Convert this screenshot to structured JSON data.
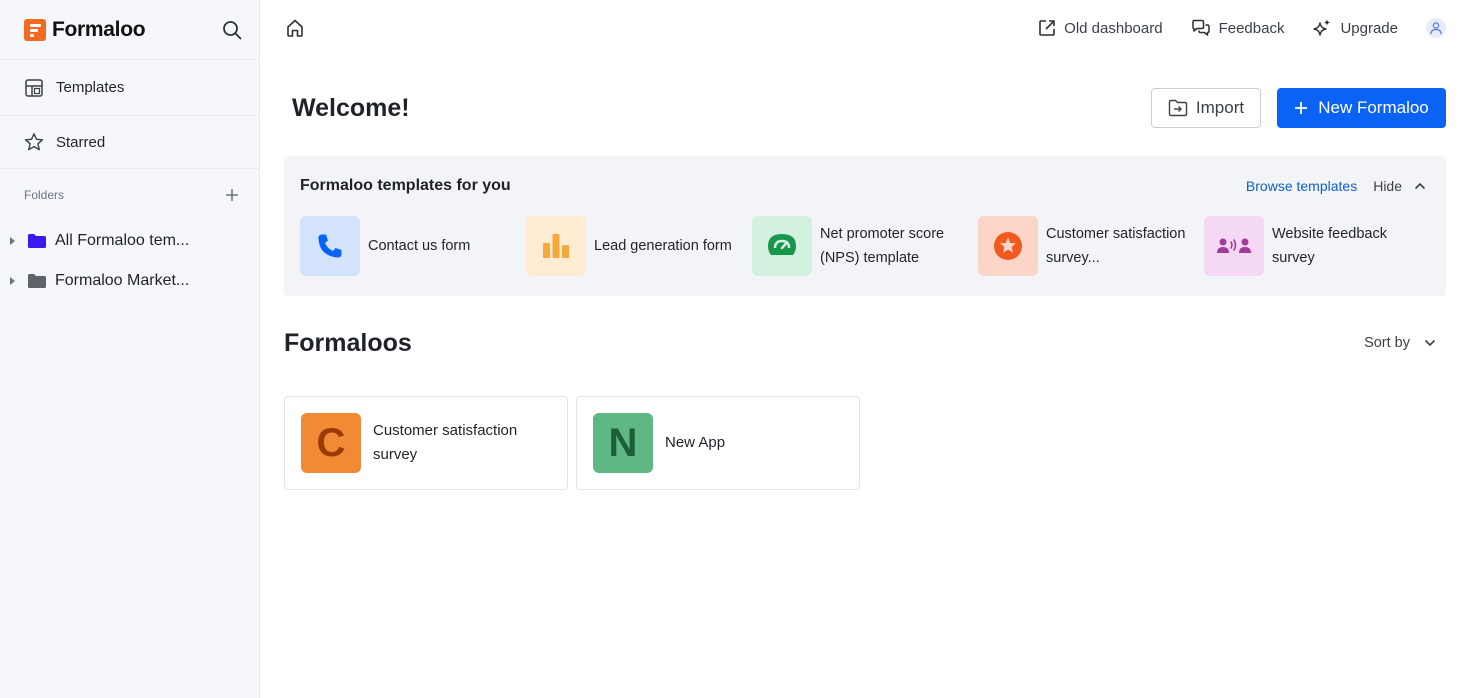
{
  "brand": {
    "name": "Formaloo",
    "accent": "#f26a21"
  },
  "sidebar": {
    "nav": [
      {
        "label": "Templates",
        "icon": "templates-icon"
      },
      {
        "label": "Starred",
        "icon": "star-icon"
      }
    ],
    "folders_title": "Folders",
    "folders": [
      {
        "label": "All Formaloo tem...",
        "color": "#3b17f0"
      },
      {
        "label": "Formaloo Market...",
        "color": "#5d626b"
      }
    ]
  },
  "topbar": {
    "old_dashboard": "Old dashboard",
    "feedback": "Feedback",
    "upgrade": "Upgrade"
  },
  "main": {
    "welcome": "Welcome!",
    "import_label": "Import",
    "new_label": "New Formaloo",
    "primary_color": "#0b63f6"
  },
  "templates": {
    "title": "Formaloo templates for you",
    "browse": "Browse templates",
    "hide": "Hide",
    "items": [
      {
        "label": "Contact us form",
        "icon": "phone-icon",
        "bg": "#d3e3fb"
      },
      {
        "label": "Lead generation form",
        "icon": "bar-chart-icon",
        "bg": "#fdecd2"
      },
      {
        "label": "Net promoter score (NPS) template",
        "icon": "gauge-icon",
        "bg": "#d3f1de"
      },
      {
        "label": "Customer satisfaction survey...",
        "icon": "star-badge-icon",
        "bg": "#fbd5c7"
      },
      {
        "label": "Website feedback survey",
        "icon": "people-voice-icon",
        "bg": "#f5d8f3"
      }
    ]
  },
  "formaloos": {
    "title": "Formaloos",
    "sort_label": "Sort by",
    "cards": [
      {
        "letter": "C",
        "label": "Customer satisfaction survey",
        "bg": "#f08a35",
        "fg": "#9a3a05"
      },
      {
        "letter": "N",
        "label": "New App",
        "bg": "#5fb783",
        "fg": "#1b5e37"
      }
    ]
  }
}
